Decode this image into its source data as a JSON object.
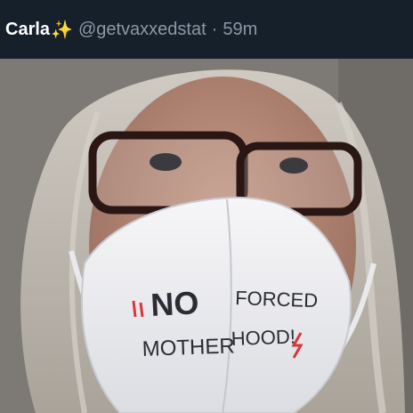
{
  "tweet": {
    "display_name": "Carla",
    "name_emoji": "✨",
    "handle": "@getvaxxedstat",
    "separator": "·",
    "time_ago": "59m"
  },
  "photo": {
    "mask_text": {
      "line1_left": "NO",
      "line1_right": "FORCED",
      "line2_left": "MOTHER",
      "line2_right": "HOOD!"
    }
  },
  "colors": {
    "background": "#15202b",
    "name": "#ffffff",
    "secondary": "#8b98a5",
    "mask_ink": "#2b2b33",
    "mask_red": "#d8363a"
  }
}
